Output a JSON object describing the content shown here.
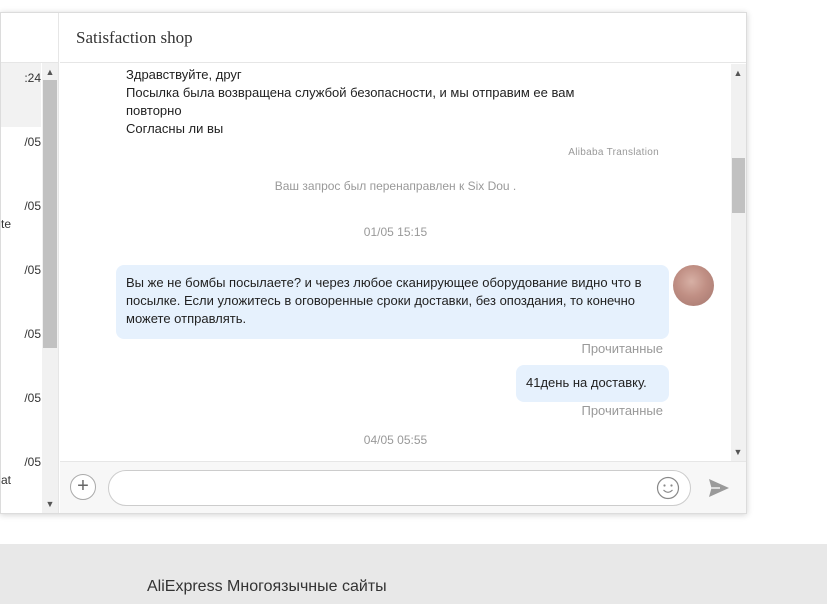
{
  "sidebar": {
    "conversations": [
      {
        "time": ":24",
        "name": ""
      },
      {
        "time": "/05",
        "name": ""
      },
      {
        "time": "/05",
        "name": "te"
      },
      {
        "time": "/05",
        "name": ""
      },
      {
        "time": "/05",
        "name": ""
      },
      {
        "time": "/05",
        "name": ""
      },
      {
        "time": "/05",
        "name": "at"
      }
    ],
    "scroll_up_icon": "chevron-up-icon",
    "scroll_down_icon": "chevron-down-icon"
  },
  "chat": {
    "title": "Satisfaction shop",
    "incoming_message": {
      "line1": "Здравствуйте, друг",
      "line2": "Посылка была возвращена службой безопасности, и мы отправим ее вам",
      "line3": "повторно",
      "line4": "Согласны ли вы",
      "translation_note": "Alibaba Translation"
    },
    "system_note": "Ваш запрос был перенаправлен к Six Dou .",
    "timestamp1": "01/05 15:15",
    "outgoing": [
      {
        "text": "Вы же не бомбы посылаете? и через любое сканирующее оборудование видно что в посылке. Если уложитесь в оговоренные сроки  доставки, без опоздания, то конечно можете отправлять.",
        "status": "Прочитанные"
      },
      {
        "text": "41день на доставку.",
        "status": "Прочитанные"
      }
    ],
    "timestamp2": "04/05 05:55"
  },
  "composer": {
    "placeholder": "",
    "value": "",
    "plus_icon": "plus-icon",
    "emoji_icon": "emoji-icon",
    "send_icon": "send-icon"
  },
  "footer": {
    "text": "AliExpress Многоязычные сайты"
  }
}
